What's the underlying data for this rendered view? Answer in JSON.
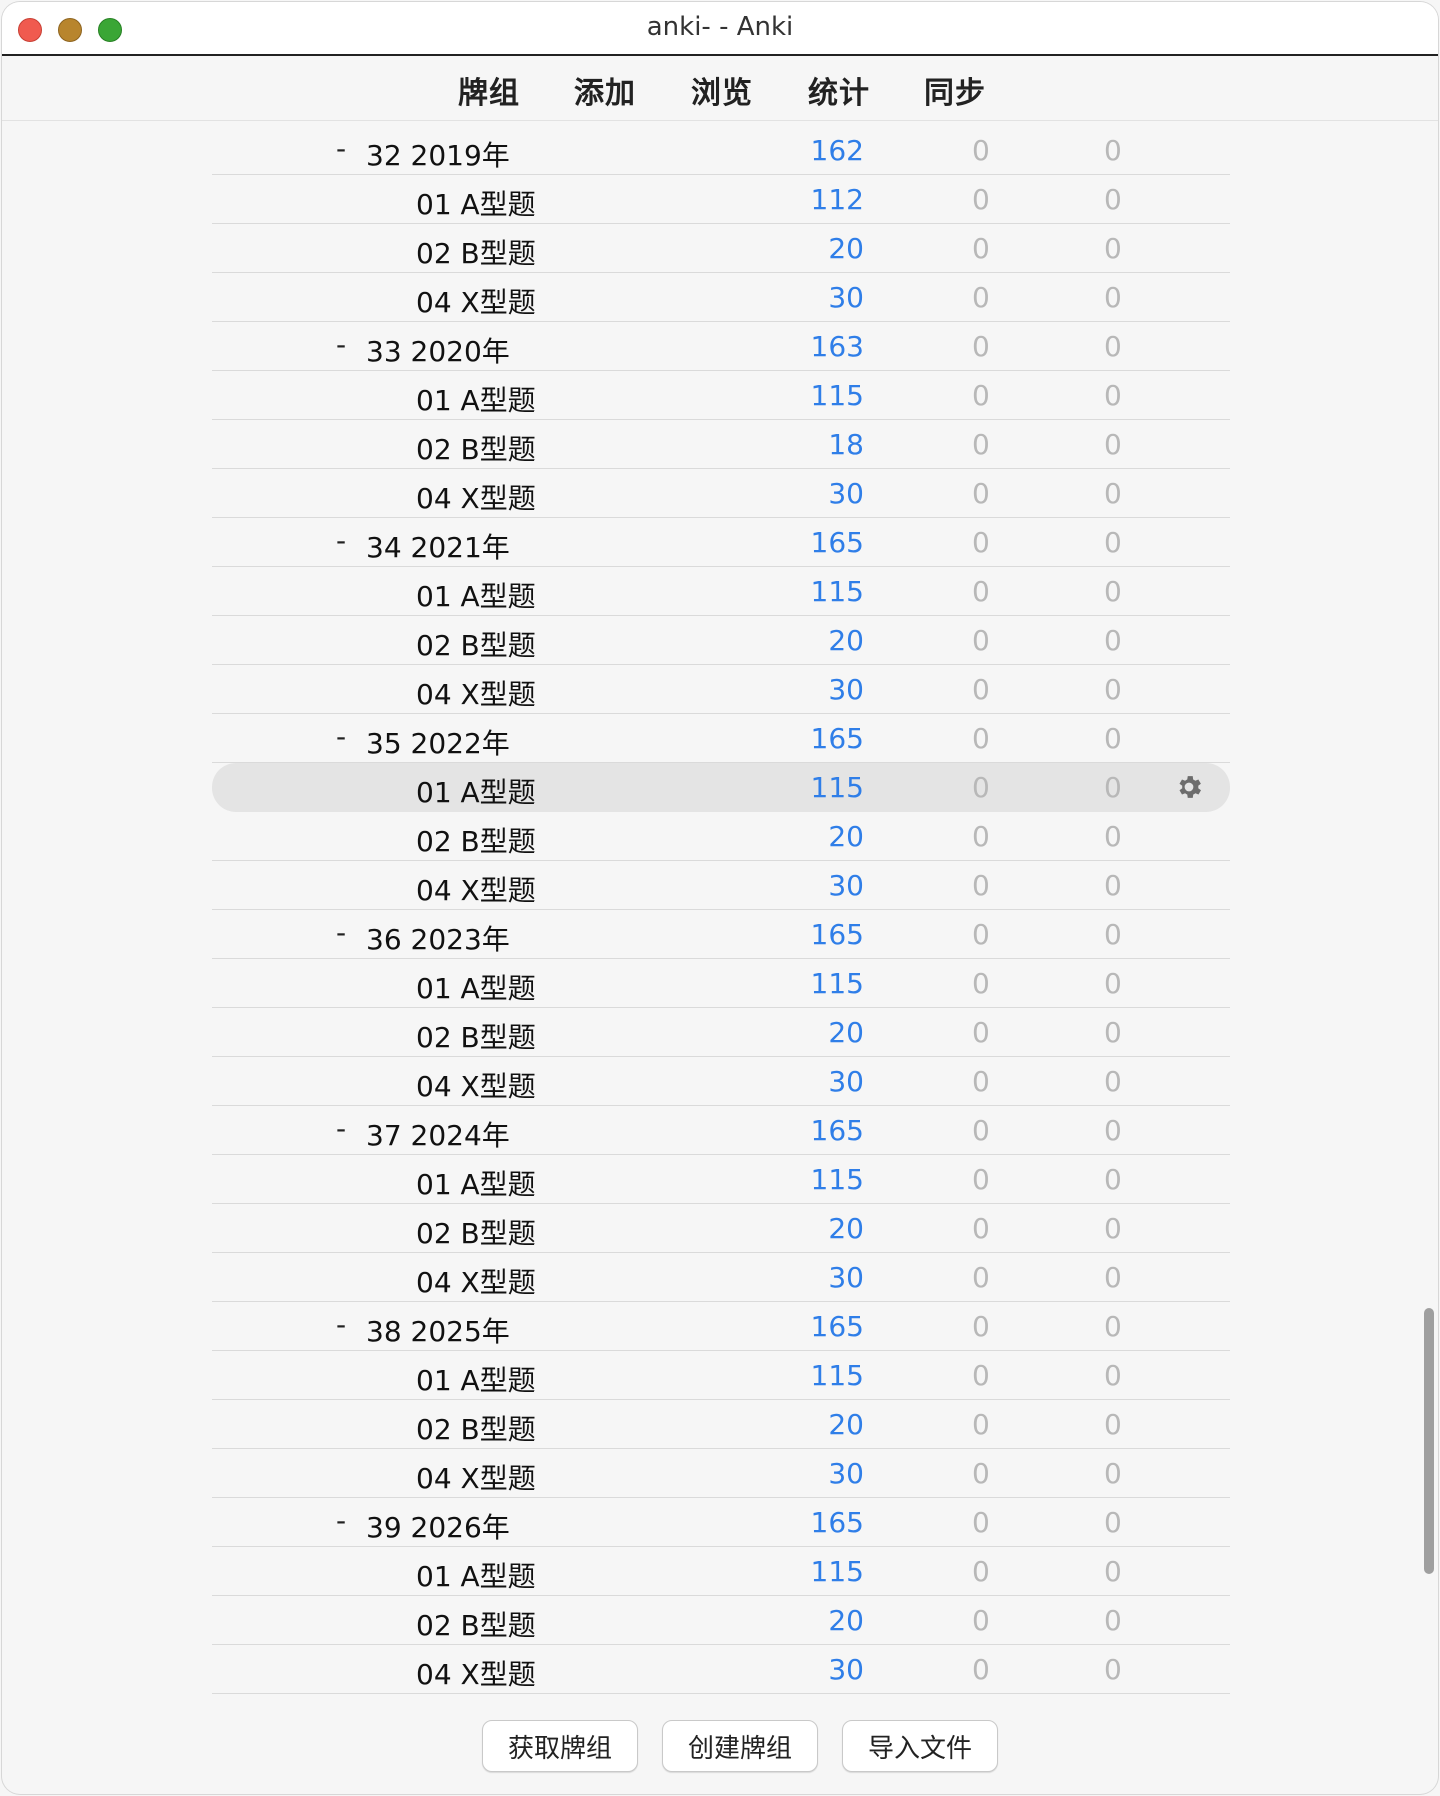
{
  "window": {
    "title": "anki- - Anki"
  },
  "nav": {
    "decks": "牌组",
    "add": "添加",
    "browse": "浏览",
    "stats": "统计",
    "sync": "同步"
  },
  "deck_rows": [
    {
      "name": "32 2019年",
      "new": "162",
      "learn": "0",
      "review": "0",
      "parent": true
    },
    {
      "name": "01 A型题",
      "new": "112",
      "learn": "0",
      "review": "0"
    },
    {
      "name": "02 B型题",
      "new": "20",
      "learn": "0",
      "review": "0"
    },
    {
      "name": "04 X型题",
      "new": "30",
      "learn": "0",
      "review": "0"
    },
    {
      "name": "33 2020年",
      "new": "163",
      "learn": "0",
      "review": "0",
      "parent": true
    },
    {
      "name": "01 A型题",
      "new": "115",
      "learn": "0",
      "review": "0"
    },
    {
      "name": "02 B型题",
      "new": "18",
      "learn": "0",
      "review": "0"
    },
    {
      "name": "04 X型题",
      "new": "30",
      "learn": "0",
      "review": "0"
    },
    {
      "name": "34 2021年",
      "new": "165",
      "learn": "0",
      "review": "0",
      "parent": true
    },
    {
      "name": "01 A型题",
      "new": "115",
      "learn": "0",
      "review": "0"
    },
    {
      "name": "02 B型题",
      "new": "20",
      "learn": "0",
      "review": "0"
    },
    {
      "name": "04 X型题",
      "new": "30",
      "learn": "0",
      "review": "0"
    },
    {
      "name": "35 2022年",
      "new": "165",
      "learn": "0",
      "review": "0",
      "parent": true
    },
    {
      "name": "01 A型题",
      "new": "115",
      "learn": "0",
      "review": "0",
      "selected": true
    },
    {
      "name": "02 B型题",
      "new": "20",
      "learn": "0",
      "review": "0"
    },
    {
      "name": "04 X型题",
      "new": "30",
      "learn": "0",
      "review": "0"
    },
    {
      "name": "36 2023年",
      "new": "165",
      "learn": "0",
      "review": "0",
      "parent": true
    },
    {
      "name": "01 A型题",
      "new": "115",
      "learn": "0",
      "review": "0"
    },
    {
      "name": "02 B型题",
      "new": "20",
      "learn": "0",
      "review": "0"
    },
    {
      "name": "04 X型题",
      "new": "30",
      "learn": "0",
      "review": "0"
    },
    {
      "name": "37 2024年",
      "new": "165",
      "learn": "0",
      "review": "0",
      "parent": true
    },
    {
      "name": "01 A型题",
      "new": "115",
      "learn": "0",
      "review": "0"
    },
    {
      "name": "02 B型题",
      "new": "20",
      "learn": "0",
      "review": "0"
    },
    {
      "name": "04 X型题",
      "new": "30",
      "learn": "0",
      "review": "0"
    },
    {
      "name": "38 2025年",
      "new": "165",
      "learn": "0",
      "review": "0",
      "parent": true
    },
    {
      "name": "01 A型题",
      "new": "115",
      "learn": "0",
      "review": "0"
    },
    {
      "name": "02 B型题",
      "new": "20",
      "learn": "0",
      "review": "0"
    },
    {
      "name": "04 X型题",
      "new": "30",
      "learn": "0",
      "review": "0"
    },
    {
      "name": "39 2026年",
      "new": "165",
      "learn": "0",
      "review": "0",
      "parent": true
    },
    {
      "name": "01 A型题",
      "new": "115",
      "learn": "0",
      "review": "0"
    },
    {
      "name": "02 B型题",
      "new": "20",
      "learn": "0",
      "review": "0"
    },
    {
      "name": "04 X型题",
      "new": "30",
      "learn": "0",
      "review": "0"
    }
  ],
  "collapse_symbol": "-",
  "buttons": {
    "get_shared": "获取牌组",
    "create_deck": "创建牌组",
    "import_file": "导入文件"
  },
  "icons": {
    "gear": "gear-icon",
    "close": "close-window-icon",
    "minimize": "minimize-window-icon",
    "maximize": "maximize-window-icon"
  },
  "colors": {
    "new_count": "#2f7ee8",
    "zero_count": "#b8b8b8",
    "selected_row": "#e4e4e4"
  }
}
